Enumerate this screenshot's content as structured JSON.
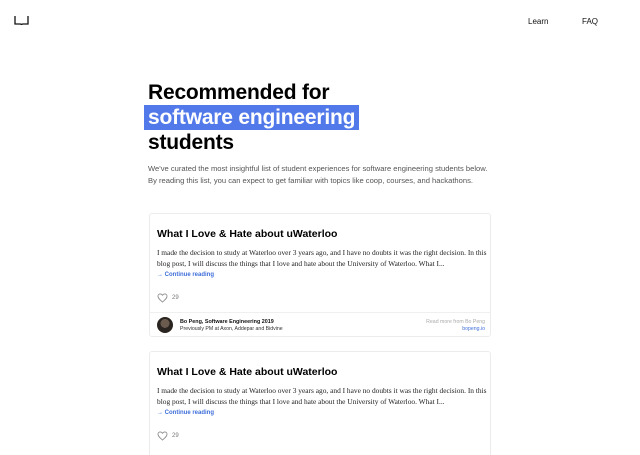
{
  "nav": {
    "learn_label": "Learn",
    "faq_label": "FAQ"
  },
  "hero": {
    "title_line1": "Recommended for",
    "title_highlight": "software engineering",
    "title_line3": "students",
    "description": "We've curated the most insightful list of student experiences for software engineering students below. By reading this list, you can expect to get familiar with topics like coop, courses, and hackathons.",
    "highlight_color": "#5279ea"
  },
  "cards": [
    {
      "title": "What I Love & Hate about uWaterloo",
      "excerpt": "I made the decision to study at Waterloo over 3 years ago, and I have no doubts it was the right decision. In this blog post, I will discuss the things that I love and hate about the University of Waterloo. What I...",
      "continue_label": "→ Continue reading",
      "likes": "29",
      "author": "Bo Peng, Software Engineering 2019",
      "role": "Previously PM at Axon, Addepar and Bidvine",
      "read_more": "Read more from Bo Peng",
      "site": "bopeng.io"
    },
    {
      "title": "What I Love & Hate about uWaterloo",
      "excerpt": "I made the decision to study at Waterloo over 3 years ago, and I have no doubts it was the right decision. In this blog post, I will discuss the things that I love and hate about the University of Waterloo. What I...",
      "continue_label": "→ Continue reading",
      "likes": "29"
    }
  ],
  "icons": {
    "logo": "book-icon",
    "like": "heart-icon"
  },
  "accent_color": "#3f6fd9"
}
